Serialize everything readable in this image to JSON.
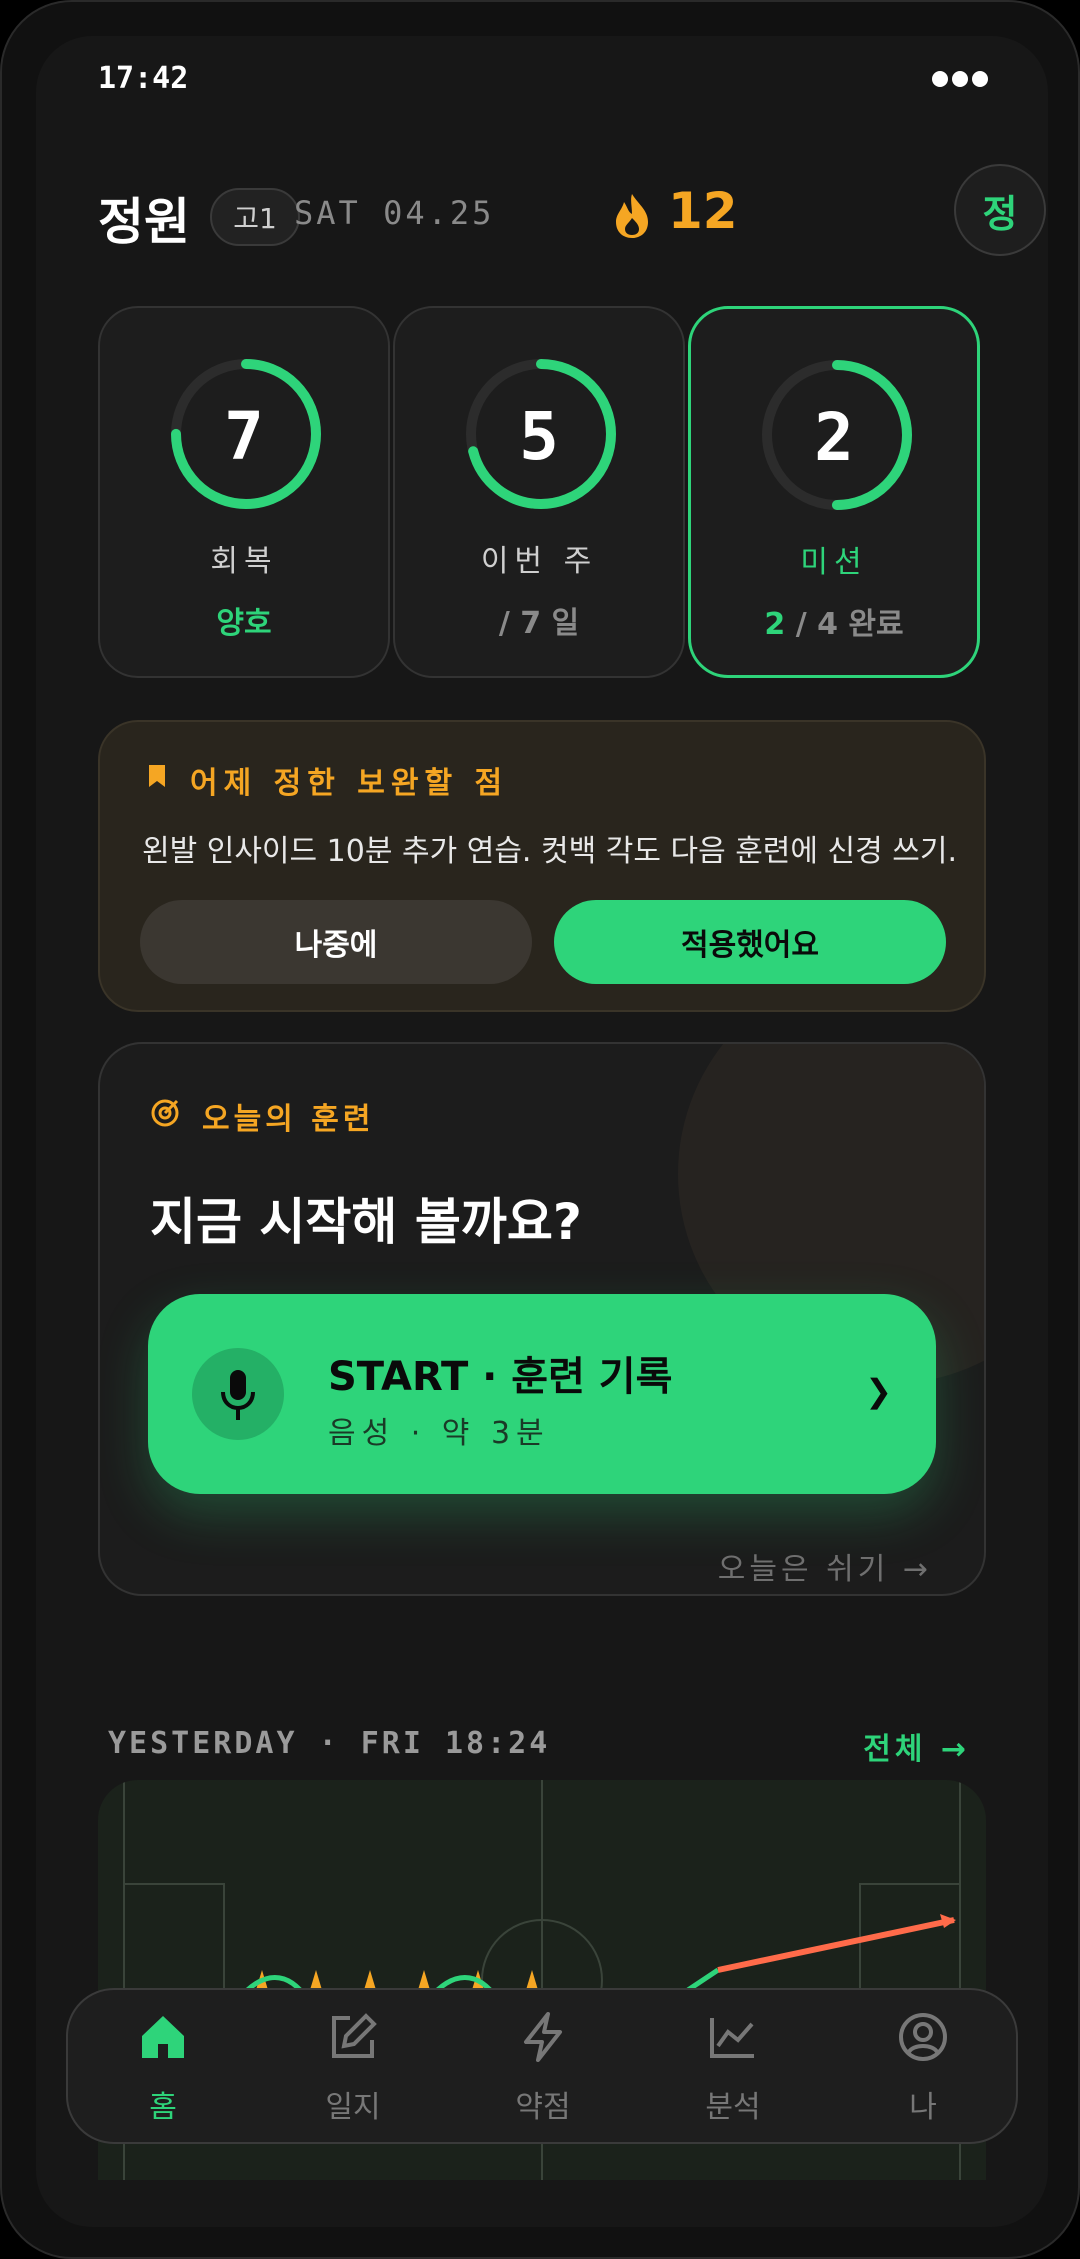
{
  "status": {
    "time": "17:42"
  },
  "header": {
    "name": "정원",
    "grade": "고1",
    "date": "SAT 04.25",
    "streak": "12",
    "avatar_initial": "정"
  },
  "stats": [
    {
      "number": "7",
      "label": "회복",
      "sub": "양호",
      "progress": 0.75
    },
    {
      "number": "5",
      "label": "이번 주",
      "sub": "/ 7 일",
      "progress": 0.71
    },
    {
      "number": "2",
      "label": "미션",
      "sub_highlight": "2",
      "sub_rest": " / 4 완료",
      "progress": 0.5
    }
  ],
  "review": {
    "title": "어제 정한 보완할 점",
    "text": "왼발 인사이드 10분 추가 연습. 컷백 각도 다음 훈련에 신경 쓰기.",
    "later_label": "나중에",
    "apply_label": "적용했어요"
  },
  "training": {
    "tag": "오늘의 훈련",
    "heading": "지금 시작해 볼까요?",
    "start_title": "START · 훈련 기록",
    "start_sub": "음성 · 약 3분",
    "rest_label": "오늘은 쉬기 →"
  },
  "yesterday": {
    "label": "YESTERDAY · FRI 18:24",
    "all_label": "전체 →"
  },
  "tabs": [
    {
      "label": "홈",
      "icon": "home-icon",
      "active": true
    },
    {
      "label": "일지",
      "icon": "edit-icon",
      "active": false
    },
    {
      "label": "약점",
      "icon": "bolt-icon",
      "active": false
    },
    {
      "label": "분석",
      "icon": "chart-icon",
      "active": false
    },
    {
      "label": "나",
      "icon": "user-icon",
      "active": false
    }
  ],
  "colors": {
    "accent": "#2ed47a",
    "warning": "#f5a623",
    "background": "#171717",
    "trail": "#ff6b4a"
  }
}
